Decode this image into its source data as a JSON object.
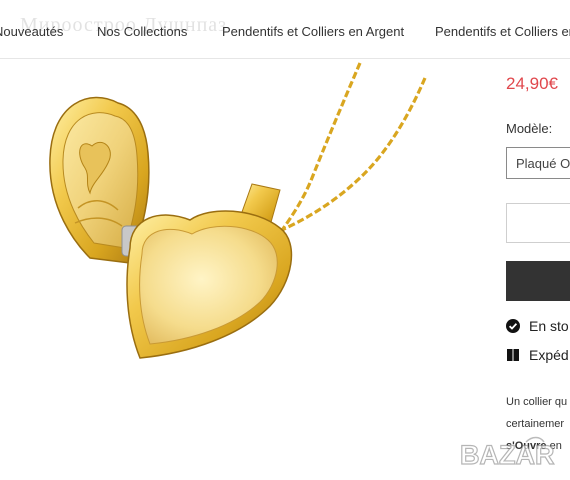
{
  "watermark": "Мироостроо Душнпаз",
  "nav": {
    "items": [
      {
        "label": "Nouveautés"
      },
      {
        "label": "Nos Collections"
      },
      {
        "label": "Pendentifs et Colliers en Argent"
      },
      {
        "label": "Pendentifs et Colliers en"
      }
    ]
  },
  "product": {
    "image_icon": "heart-locket-necklace-photo",
    "price": "24,90€",
    "variant_label": "Modèle:",
    "variant_value": "Plaqué O",
    "quantity_value": "",
    "add_to_cart_label": ""
  },
  "status": {
    "stock": "En sto",
    "stock_icon": "check-circle-icon",
    "shipping": "Expéd",
    "shipping_icon": "box-icon"
  },
  "description": {
    "line1": "Un collier qu",
    "line2": "certainemer",
    "line3_bold": "s'Ouvre",
    "line3_rest": " en"
  },
  "overlay_logo": "BAZAR",
  "colors": {
    "price": "#e0474c",
    "button": "#333333",
    "gold": "#d9a620"
  }
}
